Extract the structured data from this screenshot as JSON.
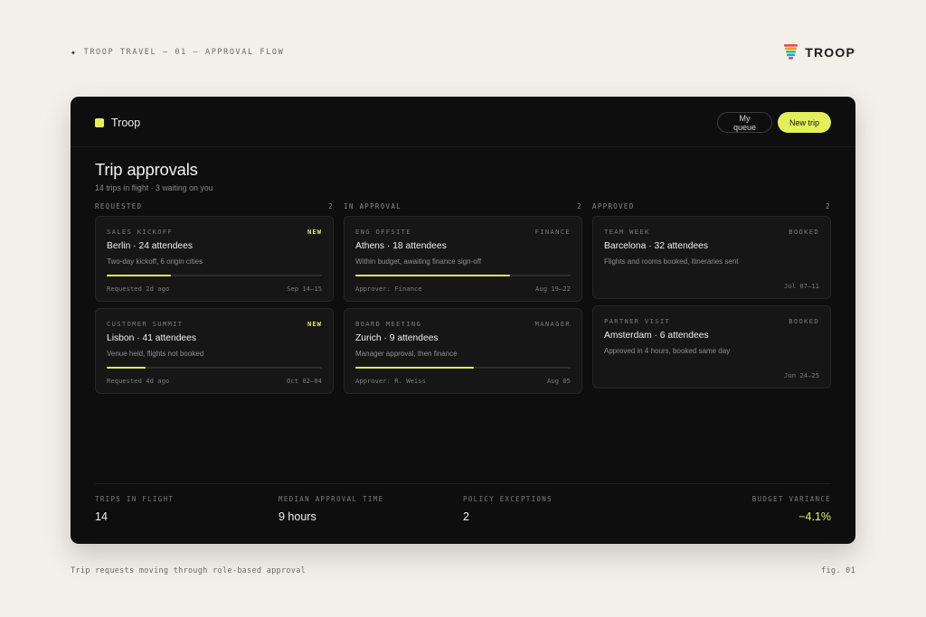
{
  "page": {
    "kicker_icon": "sparkle-icon",
    "kicker": "TROOP TRAVEL — 01 — APPROVAL FLOW",
    "brand_logo": "troop-stripes-logo",
    "brand_name": "TROOP",
    "caption": "Trip requests moving through role-based approval",
    "fig": "fig. 01"
  },
  "app": {
    "name": "Troop",
    "accent": "#e4f05a",
    "my_queue_label": "My queue",
    "new_trip_label": "New trip",
    "title": "Trip approvals",
    "subtitle": "14 trips in flight · 3 waiting on you"
  },
  "columns": [
    {
      "title": "REQUESTED",
      "count": "2",
      "cards": [
        {
          "tag": "SALES KICKOFF",
          "badge": "NEW",
          "badge_accent": true,
          "title": "Berlin · 24 attendees",
          "desc": "Two-day kickoff, 6 origin cities",
          "progress": 0.3,
          "meta": "Requested 2d ago",
          "dates": "Sep 14–15"
        },
        {
          "tag": "CUSTOMER SUMMIT",
          "badge": "NEW",
          "badge_accent": true,
          "title": "Lisbon · 41 attendees",
          "desc": "Venue held, flights not booked",
          "progress": 0.18,
          "meta": "Requested 4d ago",
          "dates": "Oct 02–04"
        }
      ]
    },
    {
      "title": "IN APPROVAL",
      "count": "2",
      "cards": [
        {
          "tag": "ENG OFFSITE",
          "badge": "FINANCE",
          "badge_accent": false,
          "title": "Athens · 18 attendees",
          "desc": "Within budget, awaiting finance sign-off",
          "progress": 0.72,
          "meta": "Approver: Finance",
          "dates": "Aug 19–22"
        },
        {
          "tag": "BOARD MEETING",
          "badge": "MANAGER",
          "badge_accent": false,
          "title": "Zurich · 9 attendees",
          "desc": "Manager approval, then finance",
          "progress": 0.55,
          "meta": "Approver: R. Weiss",
          "dates": "Aug 05"
        }
      ]
    },
    {
      "title": "APPROVED",
      "count": "2",
      "cards": [
        {
          "tag": "TEAM WEEK",
          "badge": "BOOKED",
          "badge_accent": false,
          "title": "Barcelona · 32 attendees",
          "desc": "Flights and rooms booked, itineraries sent",
          "progress": null,
          "meta": "",
          "dates": "Jul 07–11"
        },
        {
          "tag": "PARTNER VISIT",
          "badge": "BOOKED",
          "badge_accent": false,
          "title": "Amsterdam · 6 attendees",
          "desc": "Approved in 4 hours, booked same day",
          "progress": null,
          "meta": "",
          "dates": "Jun 24–25"
        }
      ]
    }
  ],
  "stats": [
    {
      "label": "TRIPS IN FLIGHT",
      "value": "14"
    },
    {
      "label": "MEDIAN APPROVAL TIME",
      "value": "9 hours"
    },
    {
      "label": "POLICY EXCEPTIONS",
      "value": "2"
    },
    {
      "label": "BUDGET VARIANCE",
      "value": "−4.1%"
    }
  ]
}
